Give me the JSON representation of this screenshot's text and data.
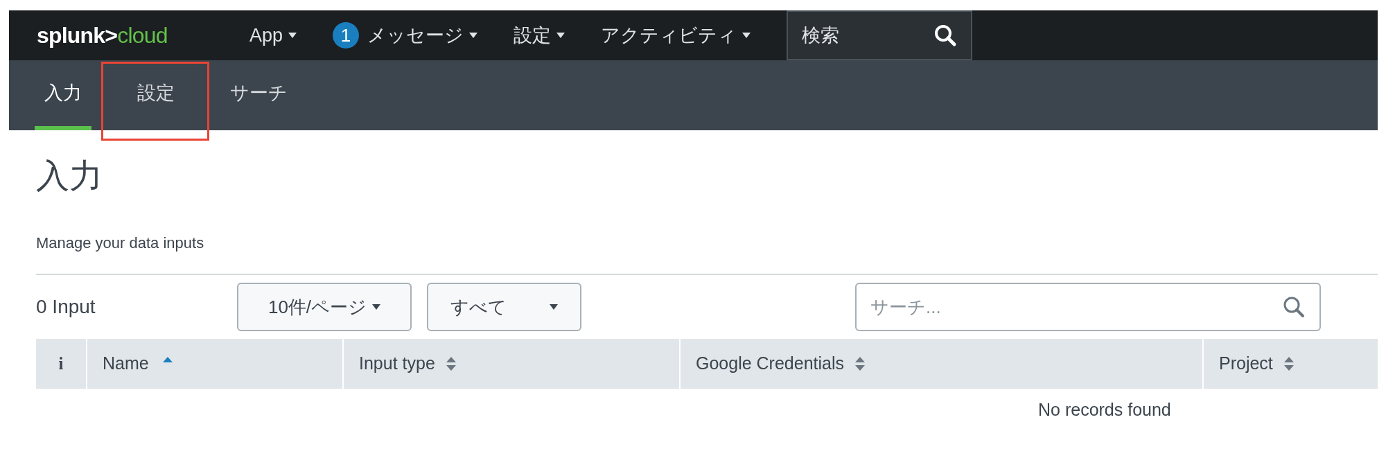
{
  "top_bar": {
    "logo": {
      "left": "splunk>",
      "right": "cloud"
    },
    "menus": [
      {
        "label": "App"
      },
      {
        "label": "メッセージ",
        "badge": "1"
      },
      {
        "label": "設定"
      },
      {
        "label": "アクティビティ"
      }
    ],
    "search": {
      "placeholder": "検索"
    }
  },
  "tabs": [
    {
      "label": "入力",
      "selected": true,
      "highlighted": false
    },
    {
      "label": "設定",
      "selected": false,
      "highlighted": true
    },
    {
      "label": "サーチ",
      "selected": false,
      "highlighted": false
    }
  ],
  "page": {
    "title": "入力",
    "subtitle": "Manage your data inputs"
  },
  "toolbar": {
    "count": "0 Input",
    "page_size": "10件/ページ",
    "filter": "すべて",
    "search": {
      "placeholder": "サーチ..."
    }
  },
  "table": {
    "columns": [
      {
        "kind": "info",
        "label": "i"
      },
      {
        "kind": "sorted",
        "label": "Name"
      },
      {
        "kind": "sortable",
        "label": "Input type"
      },
      {
        "kind": "sortable",
        "label": "Google Credentials"
      },
      {
        "kind": "sortable",
        "label": "Project"
      }
    ],
    "empty_message": "No records found"
  }
}
